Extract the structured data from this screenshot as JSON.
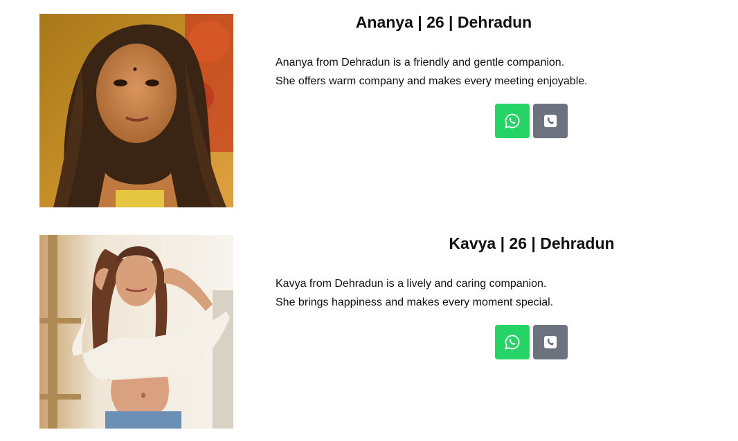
{
  "profiles": [
    {
      "title": "Ananya | 26 | Dehradun",
      "description_line_1": "Ananya from Dehradun is a friendly and gentle companion.",
      "description_line_2": "She offers warm company and makes every meeting enjoyable.",
      "whatsapp_icon": "whatsapp-icon",
      "call_icon": "phone-icon"
    },
    {
      "title": "Kavya | 26 | Dehradun",
      "description_line_1": "Kavya from Dehradun is a lively and caring companion.",
      "description_line_2": "She brings happiness and makes every moment special.",
      "whatsapp_icon": "whatsapp-icon",
      "call_icon": "phone-icon"
    }
  ],
  "colors": {
    "whatsapp": "#25d366",
    "call": "#6c737e"
  }
}
